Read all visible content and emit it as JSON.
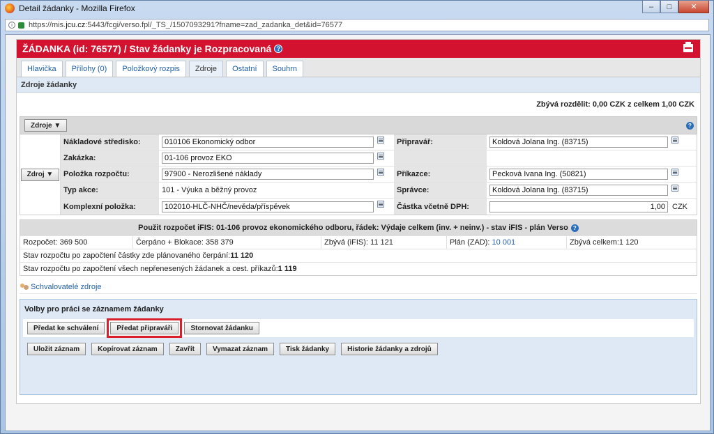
{
  "window": {
    "title": "Detail žádanky - Mozilla Firefox",
    "url_prefix": "https://mis.",
    "url_domain": "jcu.cz",
    "url_rest": ":5443/fcgi/verso.fpl/_TS_/1507093291?fname=zad_zadanka_det&id=76577"
  },
  "header": {
    "title": "ŽÁDANKA (id: 76577) / Stav žádanky je Rozpracovaná",
    "help": "?"
  },
  "tabs": [
    {
      "label": "Hlavička"
    },
    {
      "label": "Přílohy (0)"
    },
    {
      "label": "Položkový rozpis"
    },
    {
      "label": "Zdroje"
    },
    {
      "label": "Ostatní"
    },
    {
      "label": "Souhrn"
    }
  ],
  "section": {
    "title": "Zdroje žádanky",
    "remaining": "Zbývá rozdělit: 0,00 CZK z celkem 1,00 CZK",
    "zdroje_button": "Zdroje ▼",
    "zdroj_button": "Zdroj ▼"
  },
  "form": {
    "cost_center_label": "Nákladové středisko:",
    "cost_center_value": "010106 Ekonomický odbor",
    "preparer_label": "Připravář:",
    "preparer_value": "Koldová Jolana Ing.  (83715)",
    "order_label": "Zakázka:",
    "order_value": "01-106 provoz EKO",
    "budget_item_label": "Položka rozpočtu:",
    "budget_item_value": "97900 - Nerozlišené náklady",
    "issuer_label": "Příkazce:",
    "issuer_value": "Pecková Ivana Ing.  (50821)",
    "action_type_label": "Typ akce:",
    "action_type_value": "101 - Výuka a běžný provoz",
    "manager_label": "Správce:",
    "manager_value": "Koldová Jolana Ing.  (83715)",
    "complex_item_label": "Komplexní položka:",
    "complex_item_value": "102010-HLČ-NHČ/nevěda/příspěvek",
    "amount_label": "Částka včetně DPH:",
    "amount_value": "1,00",
    "currency": "CZK"
  },
  "budget": {
    "title": "Použit rozpočet iFIS: 01-106 provoz ekonomického odboru, řádek: Výdaje celkem (inv. + neinv.) - stav iFIS - plán Verso",
    "rozpocet": "Rozpočet: 369 500",
    "cerpano": "Čerpáno + Blokace: 358 379",
    "zbyva_ifis_label": "Zbývá (iFIS): ",
    "zbyva_ifis_value": "11 121",
    "plan_label": "Plán (ZAD): ",
    "plan_value": "10 001",
    "zbyva_celkem": "Zbývá celkem:1 120",
    "state1_label": "Stav rozpočtu po započtení částky zde plánovaného čerpání: ",
    "state1_value": "11 120",
    "state2_label": "Stav rozpočtu po započtení všech nepřenesených žádanek a cest. příkazů: ",
    "state2_value": "1 119"
  },
  "approvers": {
    "label": "Schvalovatelé zdroje"
  },
  "options": {
    "title": "Volby pro práci se záznamem žádanky",
    "submit_approval": "Předat ke schválení",
    "submit_preparer": "Předat připraváři",
    "cancel_request": "Stornovat žádanku",
    "save": "Uložit záznam",
    "copy": "Kopírovat záznam",
    "close": "Zavřít",
    "delete": "Vymazat záznam",
    "print": "Tisk žádanky",
    "history": "Historie žádanky a zdrojů"
  }
}
